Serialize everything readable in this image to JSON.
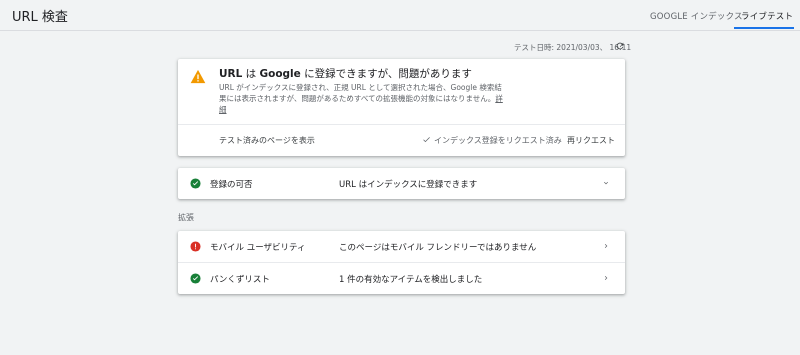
{
  "header": {
    "title": "URL 検査",
    "tabs": [
      {
        "label": "GOOGLE インデックス",
        "active": false
      },
      {
        "label": "ライブテスト",
        "active": true
      }
    ],
    "accent_color": "#1a73e8"
  },
  "test_info": {
    "date_label": "テスト日時: 2021/03/03、 16:11",
    "refresh_icon": "refresh-icon"
  },
  "status_card": {
    "icon": "warning-icon",
    "icon_color": "#f29900",
    "title_prefix": "URL",
    "title_mid": " は ",
    "title_brand": "Google",
    "title_suffix": " に登録できますが、問題があります",
    "description": "URL がインデックスに登録され、正規 URL として選択された場合、Google 検索結果には表示されますが、問題があるためすべての拡張機能の対象にはなりません。",
    "details_link": "詳細",
    "view_tested_page": "テスト済みのページを表示",
    "requested_label": "インデックス登録をリクエスト済み",
    "rerequest_label": "再リクエスト"
  },
  "availability": {
    "label": "登録の可否",
    "value": "URL はインデックスに登録できます",
    "status": "valid",
    "status_color": "#188038"
  },
  "enhancements": {
    "section_label": "拡張",
    "items": [
      {
        "label": "モバイル ユーザビリティ",
        "value": "このページはモバイル フレンドリーではありません",
        "status": "error",
        "status_color": "#d93025"
      },
      {
        "label": "パンくずリスト",
        "value": "1 件の有効なアイテムを検出しました",
        "status": "valid",
        "status_color": "#188038"
      }
    ]
  }
}
